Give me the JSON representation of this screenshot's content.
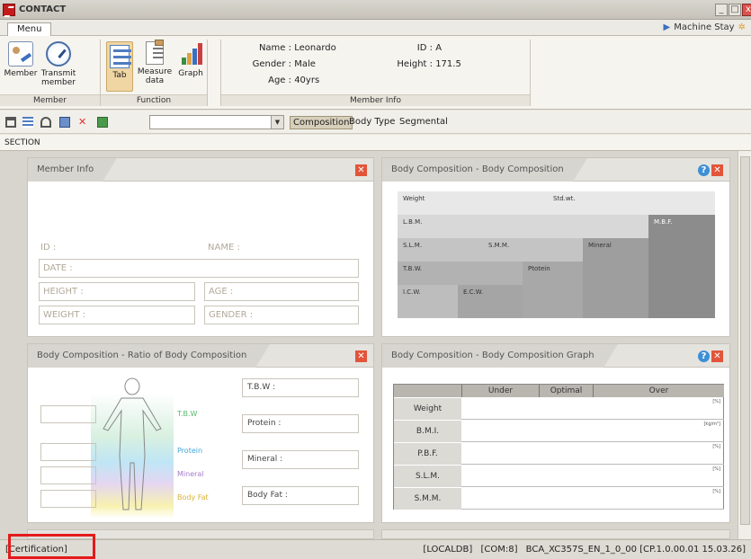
{
  "window": {
    "title": "CONTACT",
    "min": "_",
    "max": "□",
    "close": "x"
  },
  "ribbon": {
    "tab": "Menu",
    "machine_stay": "Machine Stay",
    "groups": {
      "member": {
        "label": "Member",
        "buttons": [
          "Member",
          "Transmit member"
        ]
      },
      "function": {
        "label": "Function",
        "buttons": [
          "Tab",
          "Measure data",
          "Graph"
        ]
      },
      "member_info": {
        "label": "Member Info",
        "name_k": "Name :",
        "name_v": "Leonardo",
        "gender_k": "Gender :",
        "gender_v": "Male",
        "age_k": "Age :",
        "age_v": "40yrs",
        "id_k": "ID :",
        "id_v": "A",
        "height_k": "Height :",
        "height_v": "171.5"
      }
    }
  },
  "toolbar": {
    "segments": [
      "Composition",
      "Body Type",
      "Segmental"
    ],
    "section": "SECTION"
  },
  "panels": {
    "member_info": {
      "title": "Member Info",
      "id": "ID :",
      "name": "NAME :",
      "date": "DATE :",
      "height": "HEIGHT :",
      "age": "AGE :",
      "weight": "WEIGHT :",
      "gender": "GENDER :"
    },
    "body_comp": {
      "title": "Body Composition - Body Composition",
      "cells": {
        "weight": "Weight",
        "stdwt": "Std.wt.",
        "lbm": "L.B.M.",
        "mbf": "M.B.F.",
        "slm": "S.L.M.",
        "smm": "S.M.M.",
        "mineral": "Mineral",
        "tbw": "T.B.W.",
        "protein": "Ptotein",
        "icw": "I.C.W.",
        "ecw": "E.C.W."
      }
    },
    "ratio": {
      "title": "Body Composition - Ratio of Body Composition",
      "tags": {
        "tbw": "T.B.W",
        "protein": "Protein",
        "mineral": "Mineral",
        "bodyfat": "Body Fat"
      },
      "fields": [
        "T.B.W :",
        "Protein :",
        "Mineral :",
        "Body Fat :"
      ]
    },
    "graph": {
      "title": "Body Composition - Body Composition Graph",
      "headers": [
        "Under",
        "Optimal",
        "Over"
      ],
      "rows": [
        {
          "label": "Weight",
          "unit": "[%]"
        },
        {
          "label": "B.M.I.",
          "unit": "[kg/m²]"
        },
        {
          "label": "P.B.F.",
          "unit": "[%]"
        },
        {
          "label": "S.L.M.",
          "unit": "[%]"
        },
        {
          "label": "S.M.M.",
          "unit": "[%]"
        }
      ]
    }
  },
  "status": {
    "certification": "[Certification]",
    "db": "[LOCALDB]",
    "com": "[COM:8]",
    "version": "BCA_XC357S_EN_1_0_00 [CP.1.0.00.01 15.03.26]"
  },
  "colors": {
    "close_red": "#e2553a",
    "help_blue": "#3d8fd6",
    "highlight_red": "#e31b1b"
  }
}
